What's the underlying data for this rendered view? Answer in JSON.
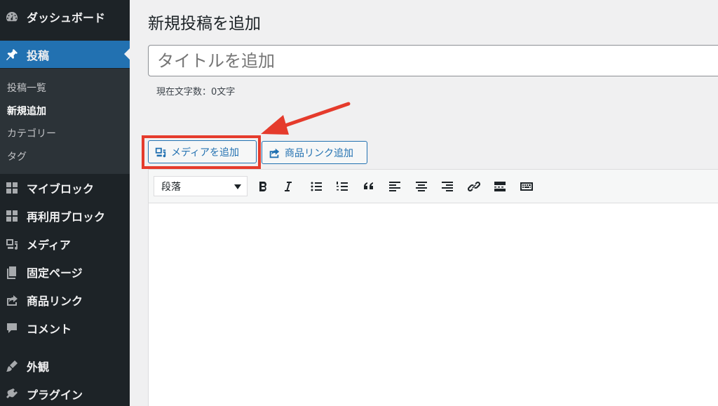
{
  "sidebar": {
    "items": [
      {
        "label": "ダッシュボード",
        "icon": "dashboard-icon"
      },
      {
        "label": "投稿",
        "icon": "pin-icon",
        "active": true
      },
      {
        "label": "マイブロック",
        "icon": "blocks-icon"
      },
      {
        "label": "再利用ブロック",
        "icon": "blocks-icon"
      },
      {
        "label": "メディア",
        "icon": "media-icon"
      },
      {
        "label": "固定ページ",
        "icon": "pages-icon"
      },
      {
        "label": "商品リンク",
        "icon": "share-icon"
      },
      {
        "label": "コメント",
        "icon": "comment-icon"
      },
      {
        "label": "外観",
        "icon": "brush-icon"
      },
      {
        "label": "プラグイン",
        "icon": "plugin-icon"
      }
    ],
    "submenu": [
      {
        "label": "投稿一覧"
      },
      {
        "label": "新規追加",
        "current": true
      },
      {
        "label": "カテゴリー"
      },
      {
        "label": "タグ"
      }
    ]
  },
  "main": {
    "page_title": "新規投稿を追加",
    "title_placeholder": "タイトルを追加",
    "char_count": "現在文字数：0文字",
    "add_media_label": "メディアを追加",
    "product_link_label": "商品リンク追加",
    "format_value": "段落"
  },
  "colors": {
    "sidebar_bg": "#1d2327",
    "accent": "#2271b1",
    "highlight": "#e53b2c"
  }
}
